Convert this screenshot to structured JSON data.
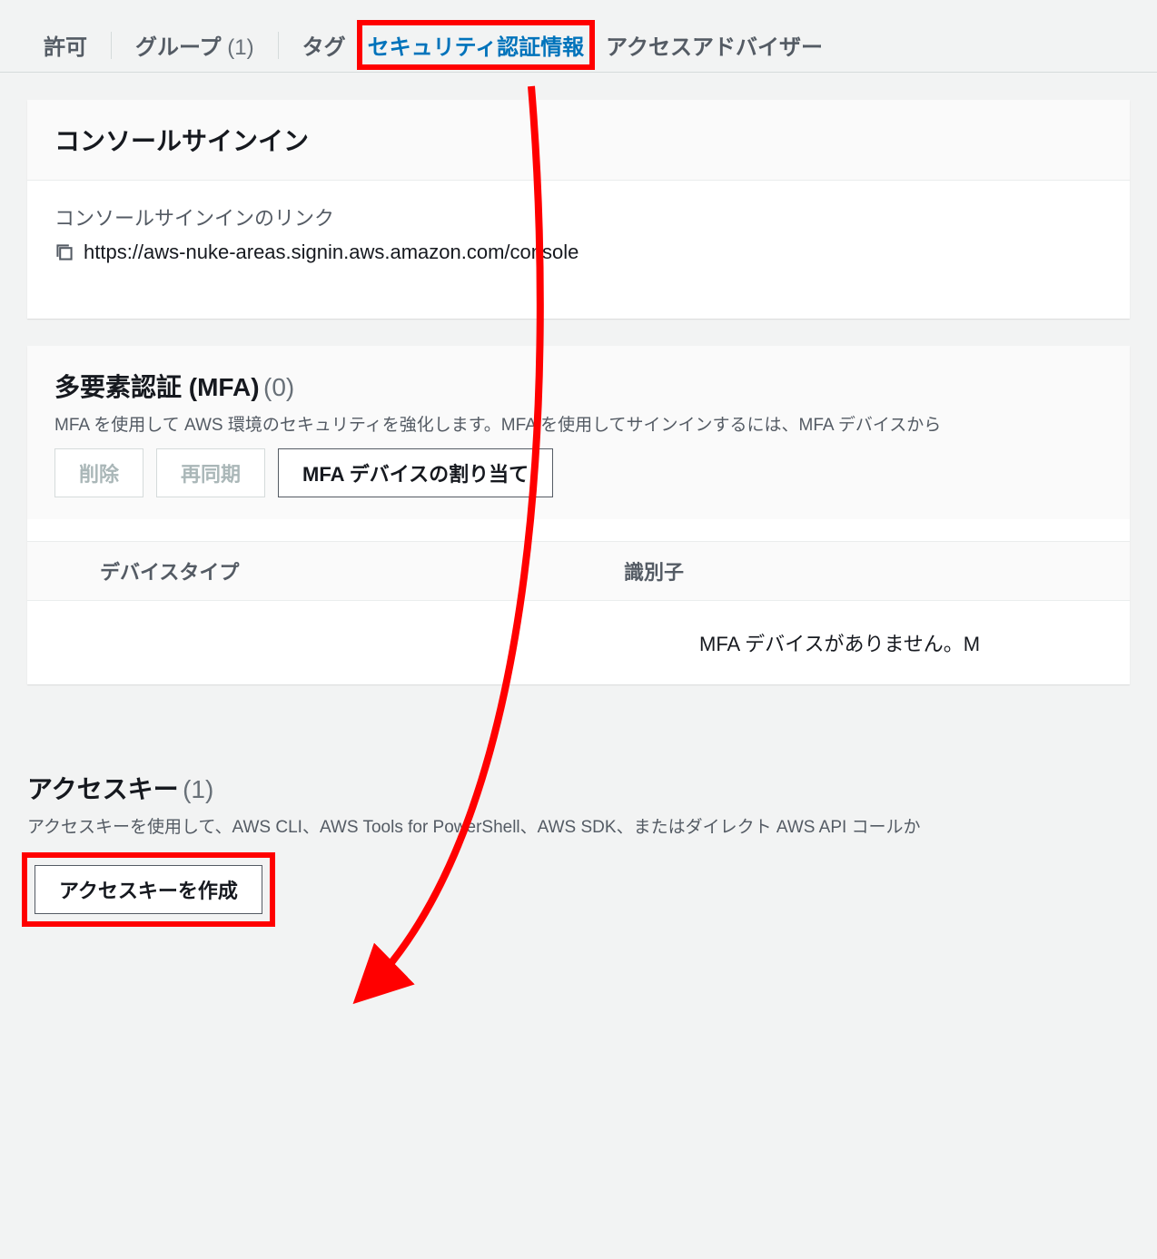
{
  "tabs": {
    "permissions": "許可",
    "groups_label": "グループ",
    "groups_count": "(1)",
    "tags": "タグ",
    "security": "セキュリティ認証情報",
    "advisor": "アクセスアドバイザー"
  },
  "console_signin": {
    "title": "コンソールサインイン",
    "link_label": "コンソールサインインのリンク",
    "link_url": "https://aws-nuke-areas.signin.aws.amazon.com/console"
  },
  "mfa": {
    "title": "多要素認証 (MFA)",
    "count": "(0)",
    "description": "MFA を使用して AWS 環境のセキュリティを強化します。MFA を使用してサインインするには、MFA デバイスから",
    "delete_btn": "削除",
    "resync_btn": "再同期",
    "assign_btn": "MFA デバイスの割り当て",
    "col_device_type": "デバイスタイプ",
    "col_identifier": "識別子",
    "empty_message": "MFA デバイスがありません。M"
  },
  "access_keys": {
    "title": "アクセスキー",
    "count": "(1)",
    "description": "アクセスキーを使用して、AWS CLI、AWS Tools for PowerShell、AWS SDK、またはダイレクト AWS API コールか",
    "create_btn": "アクセスキーを作成"
  }
}
